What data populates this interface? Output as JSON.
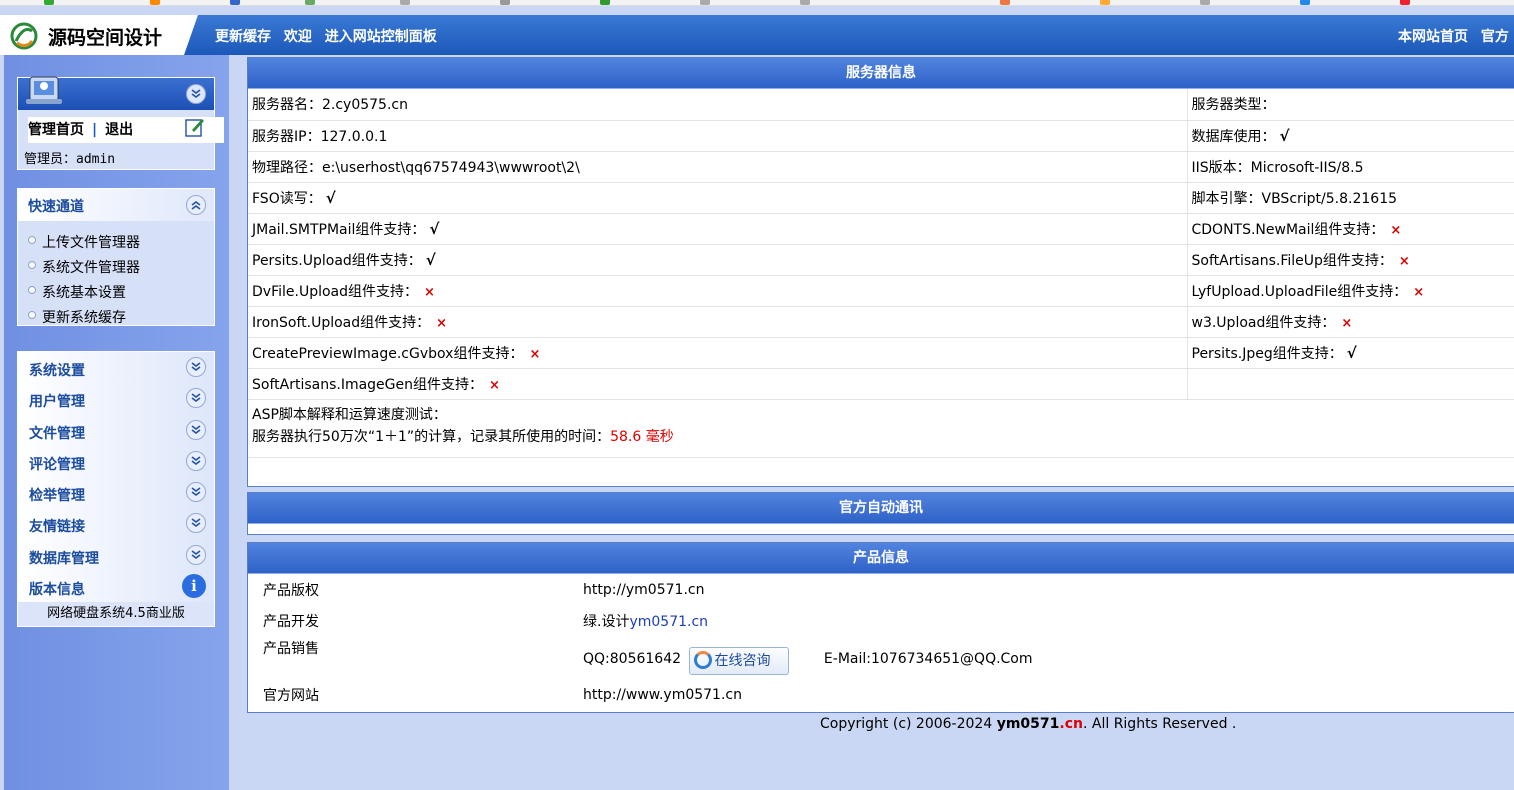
{
  "header": {
    "logo_text": "源码空间设计",
    "nav_left": [
      "更新缓存",
      "欢迎",
      "进入网站控制面板"
    ],
    "nav_right": [
      "本网站首页",
      "官方"
    ]
  },
  "sidebar": {
    "admin": {
      "home_link": "管理首页",
      "separator": "|",
      "logout_link": "退出",
      "admin_label": "管理员：admin"
    },
    "quick": {
      "title": "快速通道",
      "items": [
        "上传文件管理器",
        "系统文件管理器",
        "系统基本设置",
        "更新系统缓存"
      ]
    },
    "menu": [
      "系统设置",
      "用户管理",
      "文件管理",
      "评论管理",
      "检举管理",
      "友情链接",
      "数据库管理"
    ],
    "version": {
      "title": "版本信息",
      "text": "网络硬盘系统4.5商业版"
    }
  },
  "server": {
    "title": "服务器信息",
    "rows": [
      {
        "l": "服务器名：2.cy0575.cn",
        "lm": "",
        "r": "服务器类型：",
        "rm": ""
      },
      {
        "l": "服务器IP：127.0.0.1",
        "lm": "",
        "r": "数据库使用：",
        "rm": "√"
      },
      {
        "l": "物理路径：e:\\userhost\\qq67574943\\wwwroot\\2\\",
        "lm": "",
        "r": "IIS版本：Microsoft-IIS/8.5",
        "rm": ""
      },
      {
        "l": "FSO读写：",
        "lm": "√",
        "r": "脚本引擎：VBScript/5.8.21615",
        "rm": ""
      },
      {
        "l": "JMail.SMTPMail组件支持：",
        "lm": "√",
        "r": "CDONTS.NewMail组件支持：",
        "rm": "×"
      },
      {
        "l": "Persits.Upload组件支持：",
        "lm": "√",
        "r": "SoftArtisans.FileUp组件支持：",
        "rm": "×"
      },
      {
        "l": "DvFile.Upload组件支持：",
        "lm": "×",
        "r": "LyfUpload.UploadFile组件支持：",
        "rm": "×"
      },
      {
        "l": "IronSoft.Upload组件支持：",
        "lm": "×",
        "r": "w3.Upload组件支持：",
        "rm": "×"
      },
      {
        "l": "CreatePreviewImage.cGvbox组件支持：",
        "lm": "×",
        "r": "Persits.Jpeg组件支持：",
        "rm": "√"
      },
      {
        "l": "SoftArtisans.ImageGen组件支持：",
        "lm": "×",
        "r": "",
        "rm": ""
      }
    ],
    "speed_title": "ASP脚本解释和运算速度测试：",
    "speed_desc": "服务器执行50万次“1＋1”的计算，记录其所使用的时间：",
    "speed_result": "58.6 毫秒"
  },
  "notice": {
    "title": "官方自动通讯"
  },
  "product": {
    "title": "产品信息",
    "copyright_label": "产品版权",
    "copyright_value": "http://ym0571.cn",
    "dev_label": "产品开发",
    "dev_prefix": "绿.设计",
    "dev_link": "ym0571.cn",
    "sales_label": "产品销售",
    "sales_qq": "QQ:80561642",
    "consult_btn": "在线咨询",
    "sales_email": "E-Mail:1076734651@QQ.Com",
    "site_label": "官方网站",
    "site_value": "http://www.ym0571.cn"
  },
  "footer": {
    "prefix": "Copyright (c) 2006-2024 ",
    "brand": "ym0571",
    "brand_suffix": ".cn",
    "suffix": ". All Rights Reserved ."
  },
  "colors": {
    "header_blue": "#1c58b8",
    "sidebar_blue": "#7899e8",
    "ok_mark": "#000000",
    "error_mark": "#dd0000"
  },
  "icons": [
    "logo-icon",
    "admin-avatar-icon",
    "edit-icon",
    "chevron-down-icon",
    "chevron-up-icon",
    "info-icon",
    "consult-icon"
  ]
}
